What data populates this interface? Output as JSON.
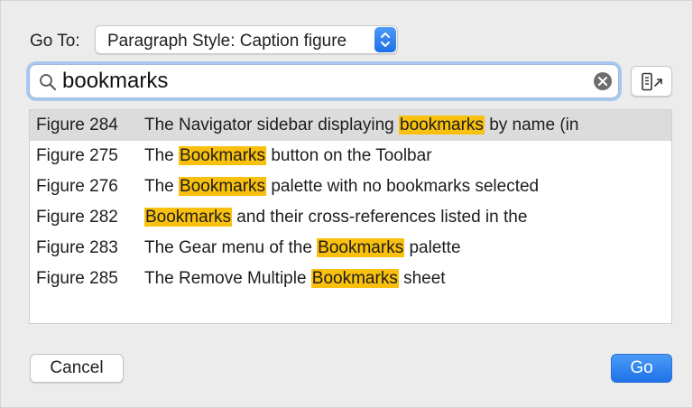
{
  "goto": {
    "label": "Go To:",
    "selected": "Paragraph Style: Caption figure"
  },
  "search": {
    "value": "bookmarks",
    "placeholder": ""
  },
  "results": [
    {
      "number": "Figure 284",
      "before": "The Navigator sidebar displaying ",
      "highlight": "bookmarks",
      "after": " by name (in",
      "selected": true
    },
    {
      "number": "Figure 275",
      "before": "The ",
      "highlight": "Bookmarks",
      "after": " button on the Toolbar",
      "selected": false
    },
    {
      "number": "Figure 276",
      "before": "The ",
      "highlight": "Bookmarks",
      "after": " palette with no bookmarks selected",
      "selected": false
    },
    {
      "number": "Figure 282",
      "before": "",
      "highlight": "Bookmarks",
      "after": " and their cross-references listed in the",
      "selected": false
    },
    {
      "number": "Figure 283",
      "before": "The Gear menu of the ",
      "highlight": "Bookmarks",
      "after": " palette",
      "selected": false
    },
    {
      "number": "Figure 285",
      "before": "The Remove Multiple ",
      "highlight": "Bookmarks",
      "after": " sheet",
      "selected": false
    }
  ],
  "buttons": {
    "cancel": "Cancel",
    "go": "Go"
  },
  "colors": {
    "highlight": "#f9c00e",
    "accent": "#1f72e8",
    "selected_row": "#dcdcdc"
  }
}
